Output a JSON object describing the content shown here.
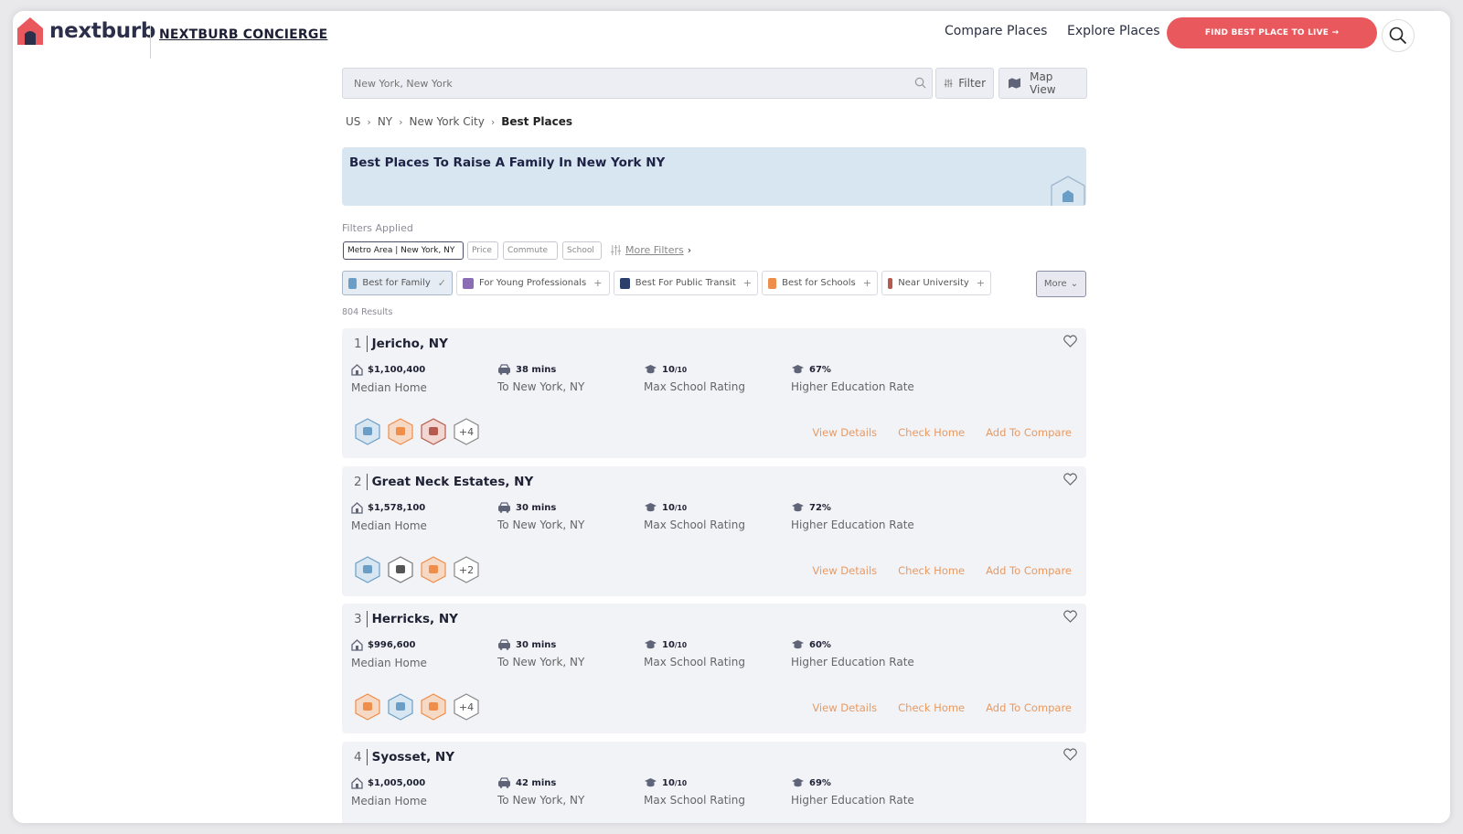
{
  "header": {
    "logo_text": "nextburb",
    "concierge": "NEXTBURB CONCIERGE",
    "nav": [
      "Compare Places",
      "Explore Places"
    ],
    "cta": "FIND BEST PLACE TO LIVE →"
  },
  "search": {
    "placeholder": "New York, New York",
    "filter_label": "Filter",
    "map_label": "Map View"
  },
  "breadcrumbs": [
    "US",
    "NY",
    "New York City",
    "Best Places"
  ],
  "banner": {
    "title": "Best Places To Raise A Family In New York NY"
  },
  "filters_applied": {
    "label": "Filters Applied",
    "chips": [
      "Metro Area | New York, NY",
      "Price",
      "Commute",
      "School"
    ],
    "more_filters": "More Filters"
  },
  "categories": [
    {
      "label": "Best for Family",
      "color": "#6a9ec7",
      "active": true
    },
    {
      "label": "For Young Professionals",
      "color": "#8a6db5"
    },
    {
      "label": "Best For Public Transit",
      "color": "#2c3f6b"
    },
    {
      "label": "Best for Schools",
      "color": "#ef8d4a"
    },
    {
      "label": "Near University",
      "color": "#b55a4e"
    }
  ],
  "more_label": "More",
  "results_count": "804 Results",
  "listings": [
    {
      "rank": "1",
      "name": "Jericho, NY",
      "median_home": "$1,100,400",
      "median_home_label": "Median Home",
      "commute": "38 mins",
      "commute_label": "To New York, NY",
      "school": "10",
      "school_suffix": "/10",
      "school_label": "Max School Rating",
      "higher_ed": "67%",
      "higher_ed_label": "Higher Education Rate",
      "extra": "+4"
    },
    {
      "rank": "2",
      "name": "Great Neck Estates, NY",
      "median_home": "$1,578,100",
      "median_home_label": "Median Home",
      "commute": "30 mins",
      "commute_label": "To New York, NY",
      "school": "10",
      "school_suffix": "/10",
      "school_label": "Max School Rating",
      "higher_ed": "72%",
      "higher_ed_label": "Higher Education Rate",
      "extra": "+2"
    },
    {
      "rank": "3",
      "name": "Herricks, NY",
      "median_home": "$996,600",
      "median_home_label": "Median Home",
      "commute": "30 mins",
      "commute_label": "To New York, NY",
      "school": "10",
      "school_suffix": "/10",
      "school_label": "Max School Rating",
      "higher_ed": "60%",
      "higher_ed_label": "Higher Education Rate",
      "extra": "+4"
    },
    {
      "rank": "4",
      "name": "Syosset, NY",
      "median_home": "$1,005,000",
      "median_home_label": "Median Home",
      "commute": "42 mins",
      "commute_label": "To New York, NY",
      "school": "10",
      "school_suffix": "/10",
      "school_label": "Max School Rating",
      "higher_ed": "69%",
      "higher_ed_label": "Higher Education Rate",
      "extra": ""
    }
  ],
  "actions": {
    "view": "View Details",
    "check": "Check Home",
    "compare": "Add To Compare"
  },
  "colors": {
    "brand_red": "#e9585c",
    "action_orange": "#e89a62",
    "banner_blue": "#d8e6f1"
  }
}
